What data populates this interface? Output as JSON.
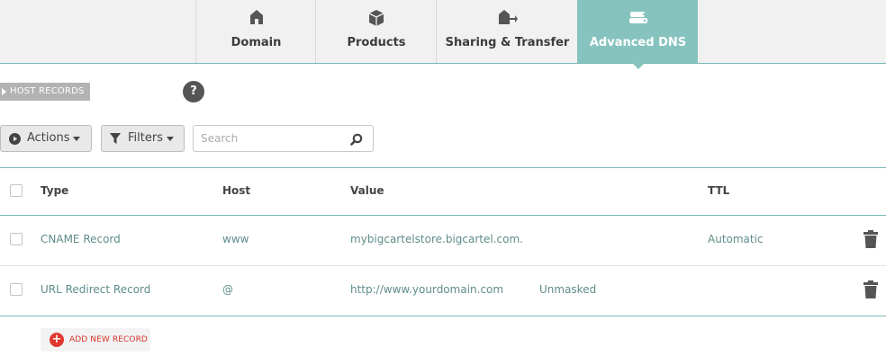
{
  "tabs": [
    {
      "label": "Domain",
      "icon": "house-icon",
      "active": false
    },
    {
      "label": "Products",
      "icon": "box-icon",
      "active": false
    },
    {
      "label": "Sharing & Transfer",
      "icon": "house-transfer-icon",
      "active": false
    },
    {
      "label": "Advanced DNS",
      "icon": "server-icon",
      "active": true
    }
  ],
  "section": {
    "title": "HOST RECORDS",
    "help": "?"
  },
  "toolbar": {
    "actions_label": "Actions",
    "filters_label": "Filters",
    "search_placeholder": "Search"
  },
  "table": {
    "headers": {
      "type": "Type",
      "host": "Host",
      "value": "Value",
      "ttl": "TTL"
    },
    "rows": [
      {
        "type": "CNAME Record",
        "host": "www",
        "value": "mybigcartelstore.bigcartel.com.",
        "extra": "",
        "ttl": "Automatic"
      },
      {
        "type": "URL Redirect Record",
        "host": "@",
        "value": "http://www.yourdomain.com",
        "extra": "Unmasked",
        "ttl": ""
      }
    ]
  },
  "add_record_label": "ADD NEW RECORD",
  "colors": {
    "accent": "#86c3be",
    "danger": "#e0382e",
    "border": "#7ab8b4"
  }
}
